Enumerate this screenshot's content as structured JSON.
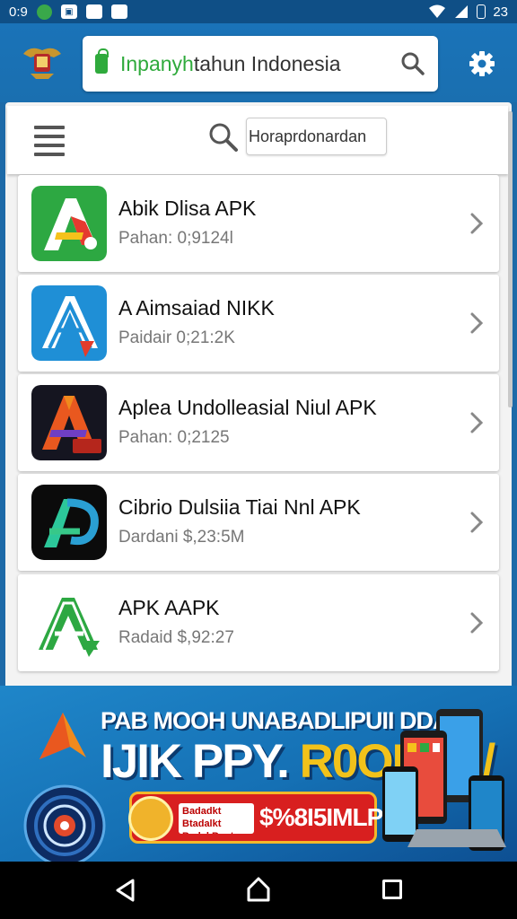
{
  "status_bar": {
    "time": "0:9",
    "battery": "23"
  },
  "browser": {
    "url_prefix": "Inpanyh",
    "url_rest": "tahun Indonesia"
  },
  "toolbar": {
    "search_value": "Horaprdonardan"
  },
  "apps": [
    {
      "name": "Abik Dlisa APK",
      "meta": "Pahan: 0;9124l",
      "icon": "apk-icon-green"
    },
    {
      "name": "A Aimsaiad NIKK",
      "meta": "Paidair 0;21:2K",
      "icon": "apk-icon-blue"
    },
    {
      "name": "Aplea Undolleasial Niul APK",
      "meta": "Pahan: 0;2125",
      "icon": "apk-icon-dark"
    },
    {
      "name": "Cibrio Dulsiia Tiai Nnl APK",
      "meta": "Dardani $,23:5M",
      "icon": "apk-icon-teal"
    },
    {
      "name": "APK AAPK",
      "meta": "Radaid $,92:27",
      "icon": "apk-icon-white"
    }
  ],
  "banner": {
    "line1": "PAB MOOH UNABADLIPUII DDAD",
    "line2_a": "IJIK PPY.",
    "line2_b": "R0OI OA/",
    "button_small": "Badadkt Btadalkt Badel Bost",
    "button_big": "$%8I5IMLP"
  },
  "colors": {
    "app_bar": "#1a73b8",
    "status_bar": "#0f4f86",
    "accent_green": "#2faa3c",
    "banner_button": "#d81f1f"
  }
}
